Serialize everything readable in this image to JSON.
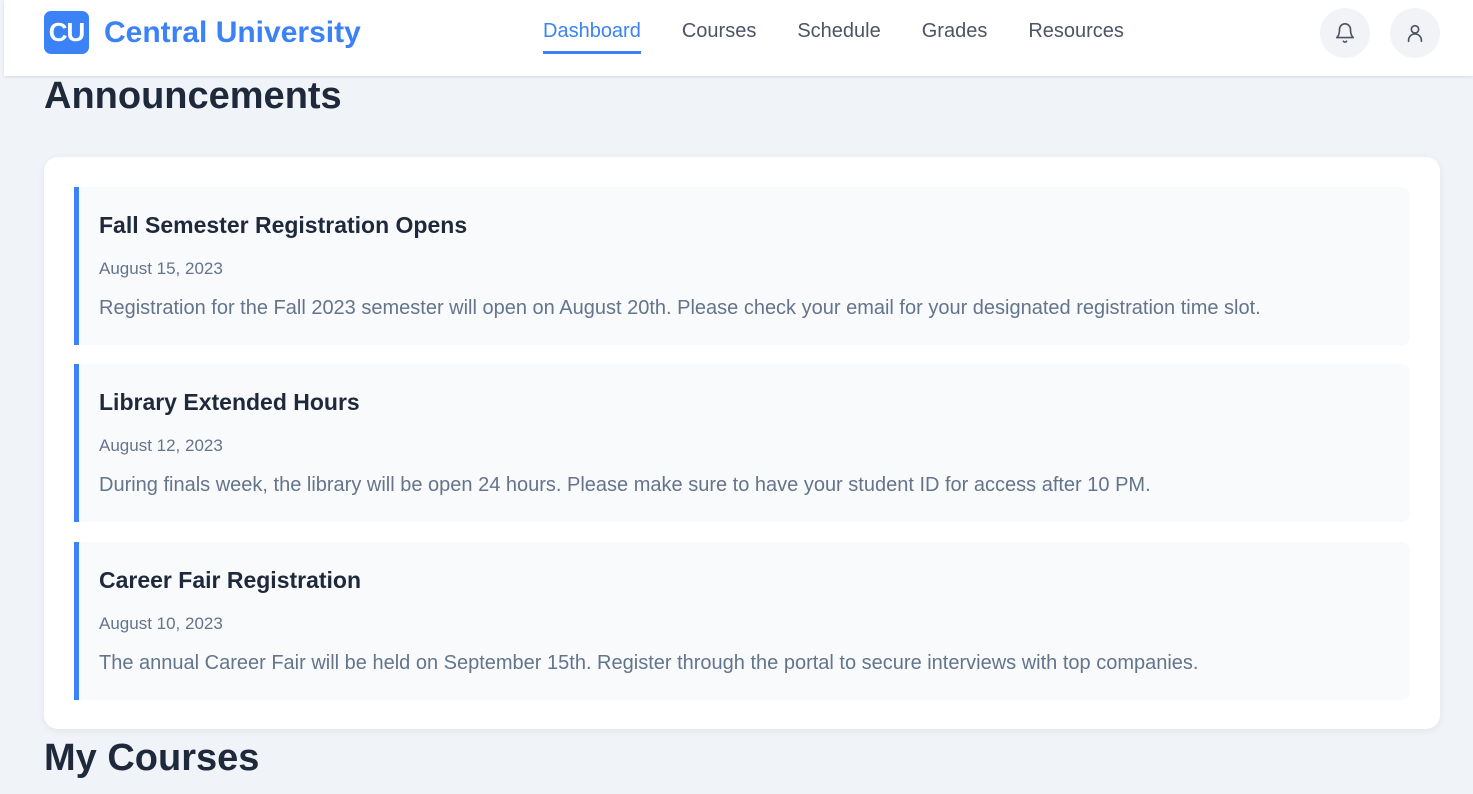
{
  "brand": {
    "logo_text": "CU",
    "name": "Central University"
  },
  "nav": {
    "items": [
      {
        "label": "Dashboard",
        "active": true
      },
      {
        "label": "Courses",
        "active": false
      },
      {
        "label": "Schedule",
        "active": false
      },
      {
        "label": "Grades",
        "active": false
      },
      {
        "label": "Resources",
        "active": false
      }
    ]
  },
  "header_icons": {
    "notifications": "bell-icon",
    "profile": "user-icon"
  },
  "announcements": {
    "title": "Announcements",
    "items": [
      {
        "title": "Fall Semester Registration Opens",
        "date": "August 15, 2023",
        "body": "Registration for the Fall 2023 semester will open on August 20th. Please check your email for your designated registration time slot."
      },
      {
        "title": "Library Extended Hours",
        "date": "August 12, 2023",
        "body": "During finals week, the library will be open 24 hours. Please make sure to have your student ID for access after 10 PM."
      },
      {
        "title": "Career Fair Registration",
        "date": "August 10, 2023",
        "body": "The annual Career Fair will be held on September 15th. Register through the portal to secure interviews with top companies."
      }
    ]
  },
  "courses": {
    "title": "My Courses"
  },
  "colors": {
    "accent": "#3b82f6",
    "background": "#f0f3f8",
    "card": "#ffffff",
    "text": "#1e293b",
    "muted": "#64748b"
  }
}
